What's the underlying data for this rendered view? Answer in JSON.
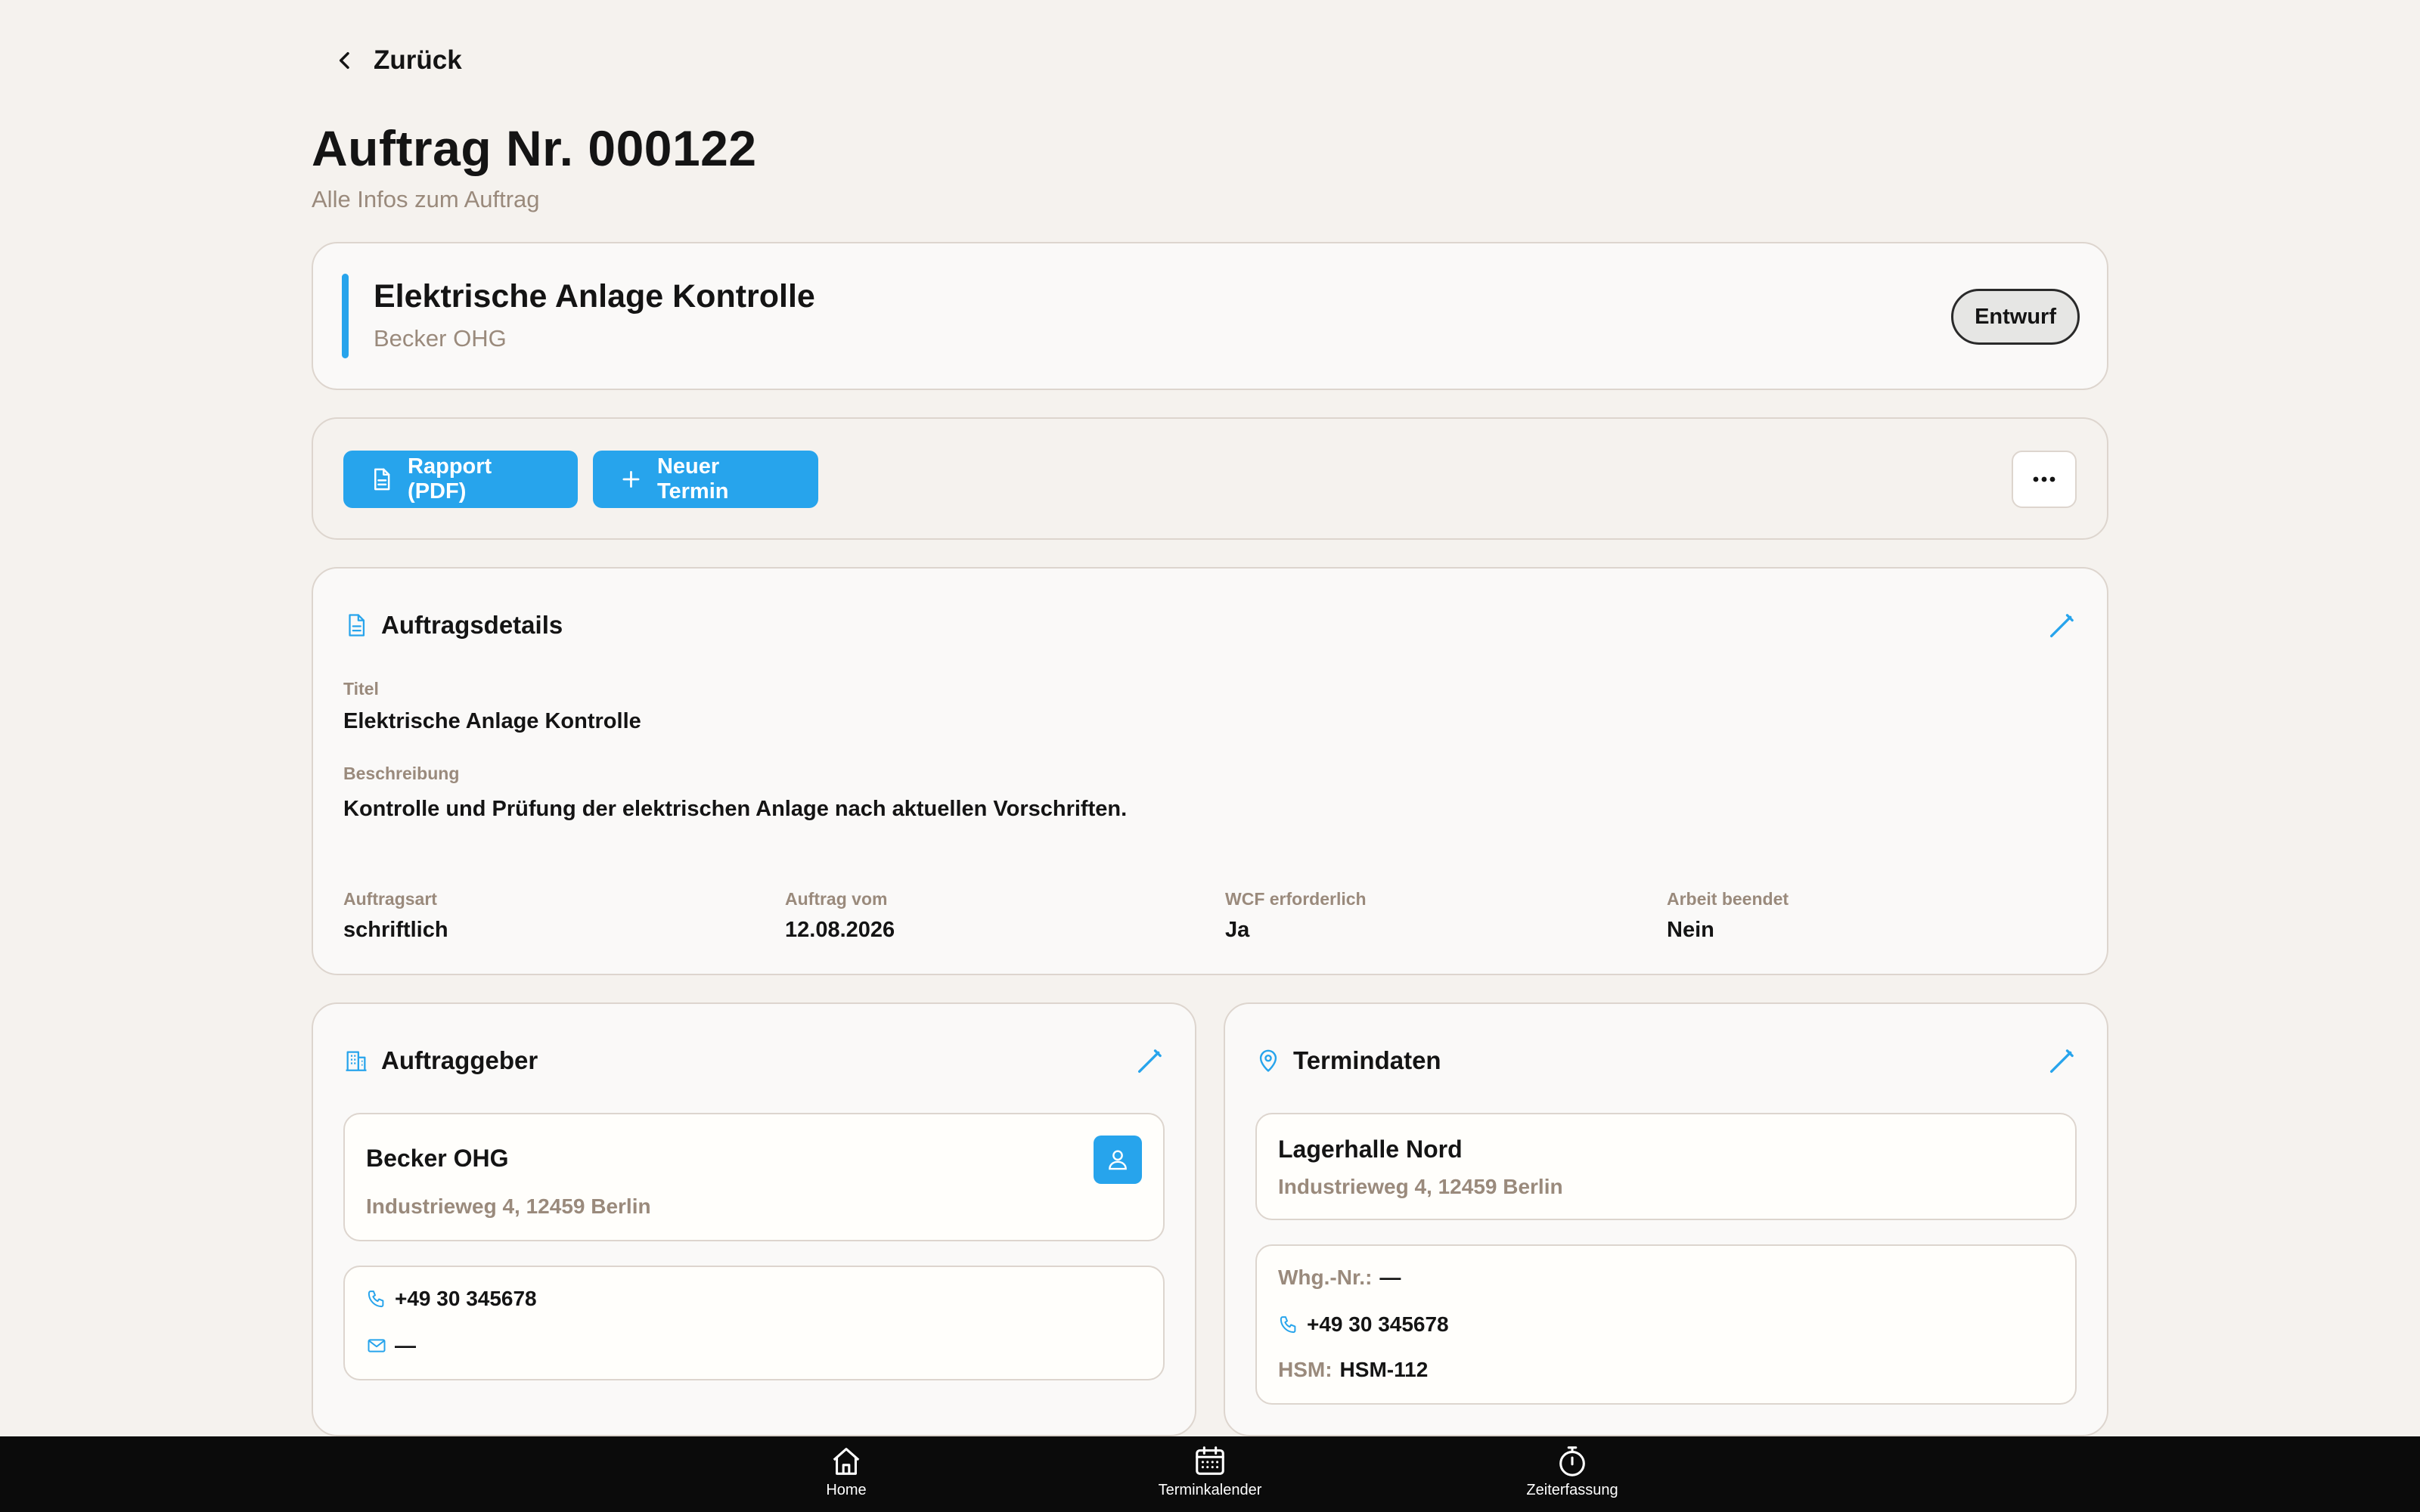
{
  "nav": {
    "back_label": "Zurück"
  },
  "page": {
    "title": "Auftrag Nr. 000122",
    "subtitle": "Alle Infos zum Auftrag"
  },
  "header": {
    "title": "Elektrische Anlage Kontrolle",
    "customer": "Becker OHG",
    "status": "Entwurf"
  },
  "actions": {
    "report_label": "Rapport (PDF)",
    "new_appointment_label": "Neuer Termin"
  },
  "details": {
    "section_title": "Auftragsdetails",
    "title_label": "Titel",
    "title_value": "Elektrische Anlage Kontrolle",
    "description_label": "Beschreibung",
    "description_value": "Kontrolle und Prüfung der elektrischen Anlage nach aktuellen Vorschriften.",
    "fields": [
      {
        "label": "Auftragsart",
        "value": "schriftlich"
      },
      {
        "label": "Auftrag vom",
        "value": "12.08.2026"
      },
      {
        "label": "WCF erforderlich",
        "value": "Ja"
      },
      {
        "label": "Arbeit beendet",
        "value": "Nein"
      }
    ]
  },
  "client": {
    "section_title": "Auftraggeber",
    "name": "Becker OHG",
    "address": "Industrieweg 4, 12459 Berlin",
    "phone": "+49 30 345678",
    "email": "—"
  },
  "appointment": {
    "section_title": "Termindaten",
    "location": "Lagerhalle Nord",
    "address": "Industrieweg 4, 12459 Berlin",
    "unit_label": "Whg.-Nr.:",
    "unit_value": "—",
    "phone": "+49 30 345678",
    "hsm_label": "HSM:",
    "hsm_value": "HSM-112"
  },
  "bottom_nav": [
    {
      "label": "Home",
      "icon": "home-icon"
    },
    {
      "label": "Terminkalender",
      "icon": "calendar-icon"
    },
    {
      "label": "Zeiterfassung",
      "icon": "stopwatch-icon"
    }
  ],
  "colors": {
    "accent": "#27a4ec",
    "background": "#f5f2ee",
    "muted": "#9a8a7c",
    "nav": "#0b0b0b"
  }
}
